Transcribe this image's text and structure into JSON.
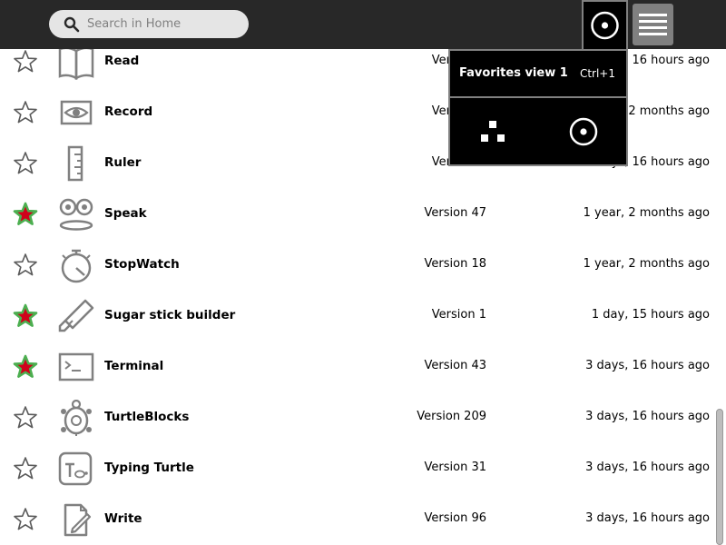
{
  "toolbar": {
    "search_placeholder": "Search in Home",
    "icons": {
      "search": "search-icon",
      "view": "favorites-view-icon",
      "menu": "hamburger-menu-icon"
    }
  },
  "palette": {
    "label": "Favorites view 1",
    "accelerator": "Ctrl+1",
    "icons": [
      "tree-view-icon",
      "favorites-view-icon"
    ]
  },
  "colors": {
    "toolbar": "#282828",
    "favorite_star_fill": "#d0021b",
    "favorite_star_stroke": "#4caf50",
    "icon_gray": "#808080"
  },
  "activities": [
    {
      "title": "Read",
      "version": "Version 1",
      "date": "3 days, 16 hours ago",
      "favorite": false,
      "icon": "book-icon"
    },
    {
      "title": "Record",
      "version": "Version 1",
      "date": "1 year, 2 months ago",
      "favorite": false,
      "icon": "eye-icon"
    },
    {
      "title": "Ruler",
      "version": "Version 1",
      "date": "3 days, 16 hours ago",
      "favorite": false,
      "icon": "ruler-icon"
    },
    {
      "title": "Speak",
      "version": "Version 47",
      "date": "1 year, 2 months ago",
      "favorite": true,
      "icon": "speak-face-icon"
    },
    {
      "title": "StopWatch",
      "version": "Version 18",
      "date": "1 year, 2 months ago",
      "favorite": false,
      "icon": "stopwatch-icon"
    },
    {
      "title": "Sugar stick builder",
      "version": "Version 1",
      "date": "1 day, 15 hours ago",
      "favorite": true,
      "icon": "usb-stick-icon"
    },
    {
      "title": "Terminal",
      "version": "Version 43",
      "date": "3 days, 16 hours ago",
      "favorite": true,
      "icon": "terminal-icon"
    },
    {
      "title": "TurtleBlocks",
      "version": "Version 209",
      "date": "3 days, 16 hours ago",
      "favorite": false,
      "icon": "turtle-icon"
    },
    {
      "title": "Typing Turtle",
      "version": "Version 31",
      "date": "3 days, 16 hours ago",
      "favorite": false,
      "icon": "typing-turtle-icon"
    },
    {
      "title": "Write",
      "version": "Version 96",
      "date": "3 days, 16 hours ago",
      "favorite": false,
      "icon": "write-icon"
    }
  ]
}
